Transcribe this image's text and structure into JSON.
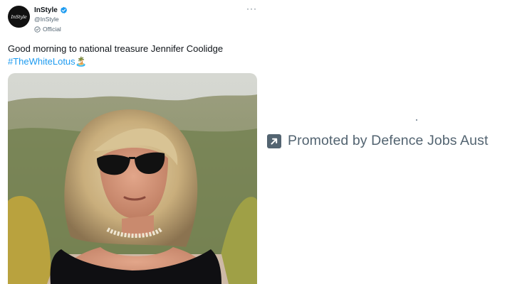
{
  "tweet": {
    "avatar_text": "InStyle",
    "display_name": "InStyle",
    "handle": "@InStyle",
    "official_label": "Official",
    "more_label": "···",
    "text": "Good morning to national treasure Jennifer Coolidge ",
    "hashtag": "#TheWhiteLotus",
    "hashtag_emoji": "🏝️",
    "verified_color": "#1d9bf0",
    "media_description": "photo"
  },
  "ad": {
    "promoted_text": "Promoted by Defence Jobs Aust",
    "icon": "promoted-arrow-icon"
  },
  "colors": {
    "text": "#0f1419",
    "secondary": "#536471",
    "link": "#1d9bf0"
  }
}
